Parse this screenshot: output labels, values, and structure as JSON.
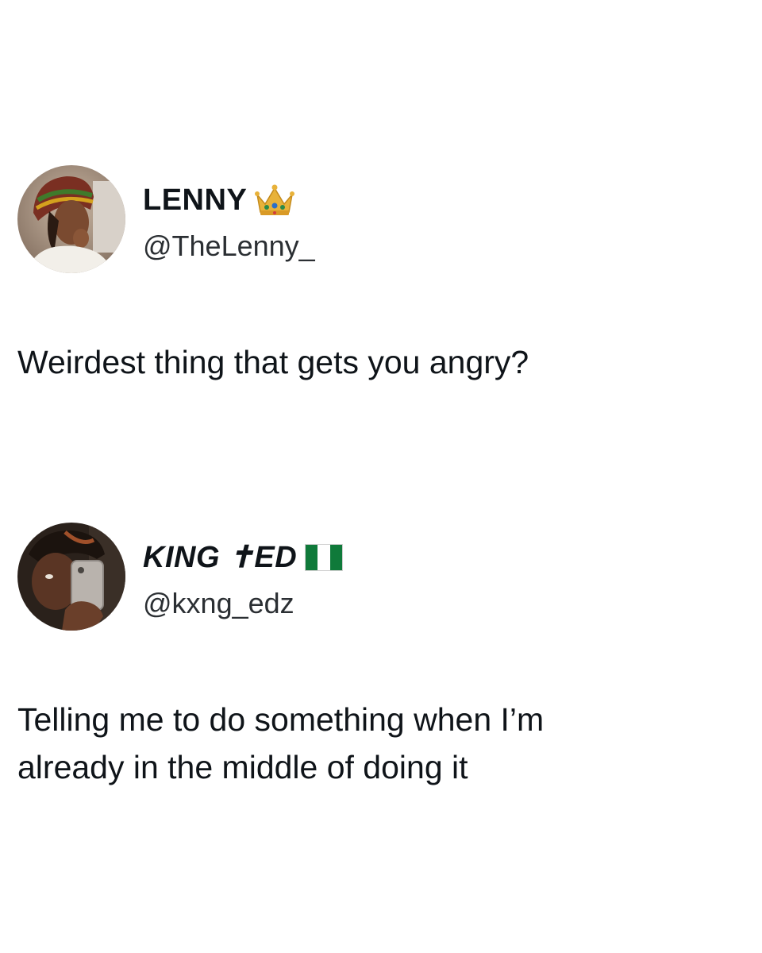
{
  "posts": [
    {
      "display_name": "LENNY",
      "badge_icon": "crown-icon",
      "handle": "@TheLenny_",
      "text_lines": [
        "Weirdest thing that gets you angry?"
      ]
    },
    {
      "display_name": "KING ✝ED",
      "badge_icon": "nigeria-flag-icon",
      "handle": "@kxng_edz",
      "text_lines": [
        "Telling me to do something when I’m",
        "already in the middle of doing it"
      ]
    }
  ],
  "colors": {
    "background": "#ffffff",
    "text": "#0f1419",
    "flag_green": "#0f7a3a",
    "crown_gold": "#e8b23a"
  }
}
